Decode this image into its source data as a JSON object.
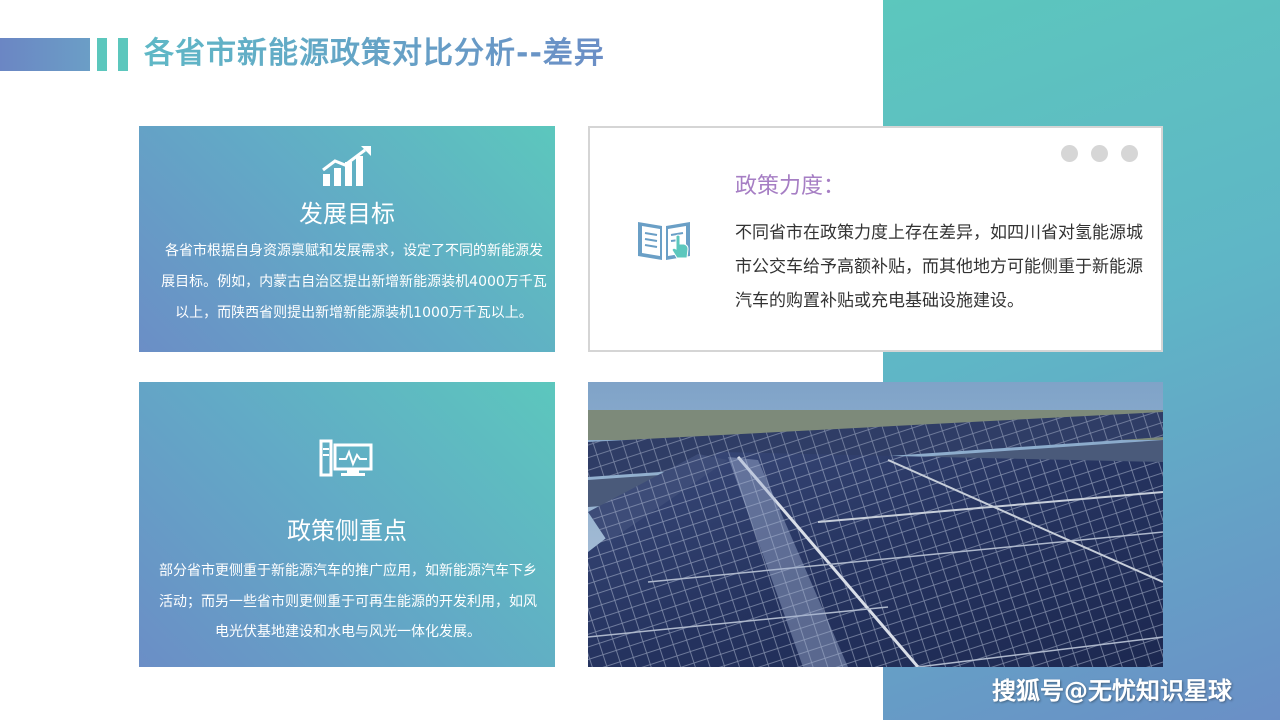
{
  "page": {
    "title": "各省市新能源政策对比分析--差异",
    "accent_color": "#5cc7bd",
    "secondary_color": "#6b8ec6"
  },
  "cards": {
    "development_goals": {
      "icon": "bar-chart-growth-icon",
      "title": "发展目标",
      "body": "各省市根据自身资源禀赋和发展需求，设定了不同的新能源发展目标。例如，内蒙古自治区提出新增新能源装机4000万千瓦以上，而陕西省则提出新增新能源装机1000万千瓦以上。"
    },
    "policy_focus": {
      "icon": "computer-monitor-icon",
      "title": "政策侧重点",
      "body": "部分省市更侧重于新能源汽车的推广应用，如新能源汽车下乡活动；而另一些省市则更侧重于可再生能源的开发利用，如风电光伏基地建设和水电与风光一体化发展。"
    },
    "policy_strength": {
      "icon": "open-book-icon",
      "title": "政策力度：",
      "body": "不同省市在政策力度上存在差异，如四川省对氢能源城市公交车给予高额补贴，而其他地方可能侧重于新能源汽车的购置补贴或充电基础设施建设。",
      "title_color": "#a67ec4"
    }
  },
  "watermark": "搜狐号@无忧知识星球"
}
